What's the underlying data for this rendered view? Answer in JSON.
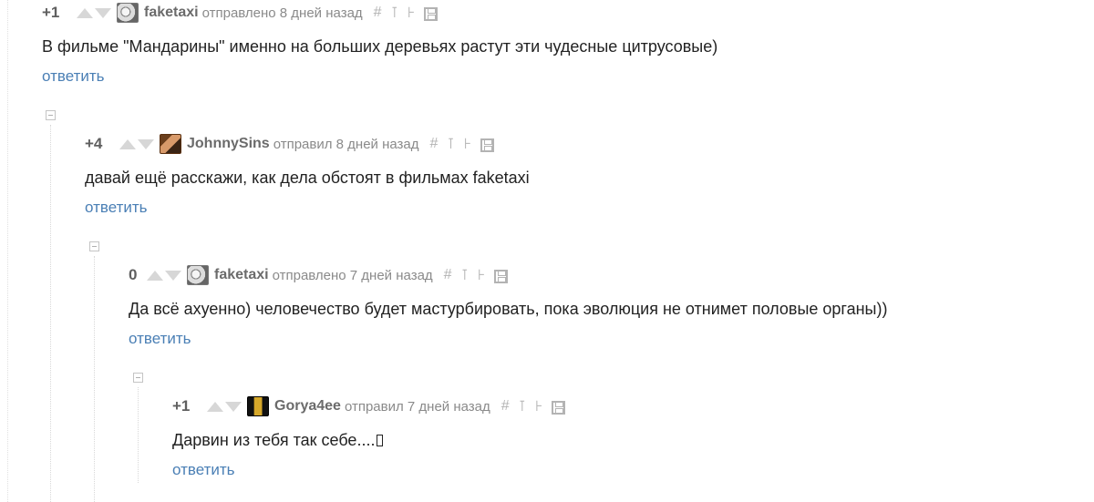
{
  "comments": [
    {
      "rating": "+1",
      "author": "faketaxi",
      "meta": "отправлено 8 дней назад",
      "text": "В фильме \"Мандарины\" именно на больших деревьях растут эти чудесные цитрусовые)",
      "reply": "ответить"
    },
    {
      "rating": "+4",
      "author": "JohnnySins",
      "meta": "отправил 8 дней назад",
      "text": "давай ещё расскажи, как дела обстоят в фильмах faketaxi",
      "reply": "ответить"
    },
    {
      "rating": "0",
      "author": "faketaxi",
      "meta": "отправлено 7 дней назад",
      "text": "Да всё ахуенно) человечество будет мастурбировать, пока эволюция не отнимет половые органы))",
      "reply": "ответить"
    },
    {
      "rating": "+1",
      "author": "Gorya4ee",
      "meta": "отправил 7 дней назад",
      "text": "Дарвин из тебя так себе....",
      "reply": "ответить"
    }
  ],
  "tools": {
    "hash": "#",
    "parent": "⊺",
    "branch": "⊦"
  },
  "icons": {
    "upvote": "arrow-up-icon",
    "downvote": "arrow-down-icon",
    "save": "save-icon",
    "collapse": "collapse-icon"
  },
  "colors": {
    "reply_link": "#4a7fb5",
    "text": "#222222",
    "muted": "#8a8a8a"
  }
}
